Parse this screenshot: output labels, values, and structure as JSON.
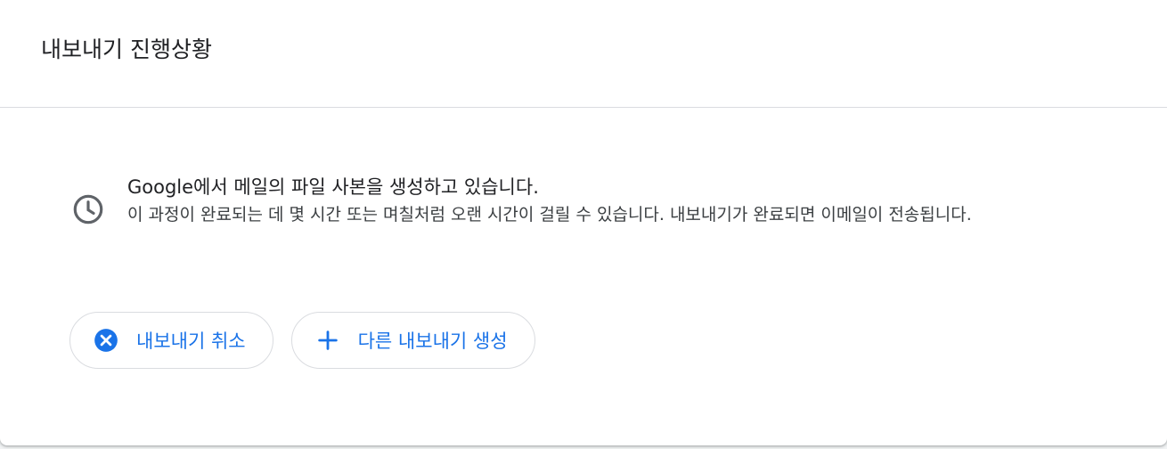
{
  "header": {
    "title": "내보내기 진행상황"
  },
  "status": {
    "icon": "clock-icon",
    "message": "Google에서 메일의 파일 사본을 생성하고 있습니다.",
    "detail": "이 과정이 완료되는 데 몇 시간 또는 며칠처럼 오랜 시간이 걸릴 수 있습니다. 내보내기가 완료되면 이메일이 전송됩니다."
  },
  "actions": {
    "cancel": {
      "label": "내보내기 취소",
      "icon": "cancel-circle-icon"
    },
    "create": {
      "label": "다른 내보내기 생성",
      "icon": "plus-icon"
    }
  },
  "colors": {
    "accent": "#1a73e8",
    "text": "#202124",
    "border": "#dadce0"
  }
}
